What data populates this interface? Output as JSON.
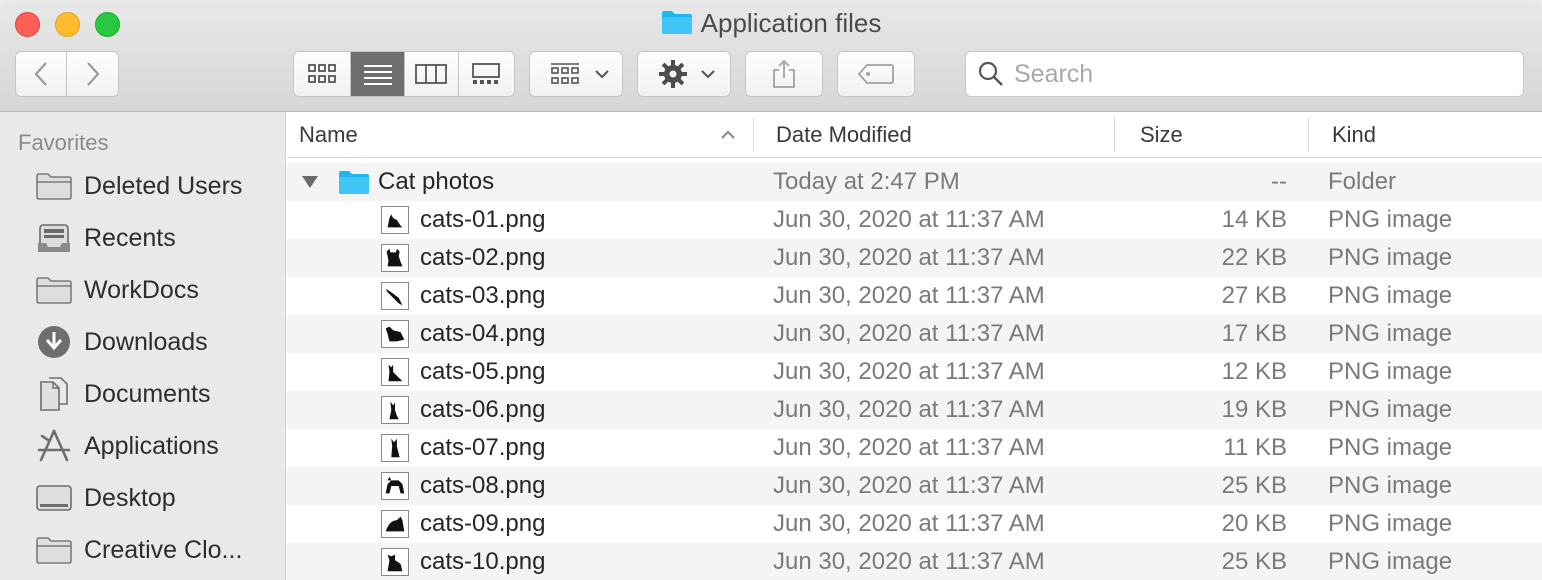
{
  "window": {
    "title": "Application files"
  },
  "toolbar": {
    "back_icon": "chevron-left-icon",
    "forward_icon": "chevron-right-icon",
    "view_modes": [
      "icon-view",
      "list-view",
      "column-view",
      "gallery-view"
    ],
    "active_view": "list-view",
    "group_icon": "group-grid-icon",
    "action_icon": "gear-icon",
    "share_icon": "share-icon",
    "tag_icon": "tag-icon"
  },
  "search": {
    "placeholder": "Search"
  },
  "sidebar": {
    "header": "Favorites",
    "items": [
      {
        "label": "Deleted Users",
        "icon": "folder-icon"
      },
      {
        "label": "Recents",
        "icon": "recents-icon"
      },
      {
        "label": "WorkDocs",
        "icon": "folder-icon"
      },
      {
        "label": "Downloads",
        "icon": "download-icon"
      },
      {
        "label": "Documents",
        "icon": "documents-icon"
      },
      {
        "label": "Applications",
        "icon": "applications-icon"
      },
      {
        "label": "Desktop",
        "icon": "desktop-icon"
      },
      {
        "label": "Creative Clo...",
        "icon": "folder-icon"
      }
    ]
  },
  "columns": {
    "name": "Name",
    "date": "Date Modified",
    "size": "Size",
    "kind": "Kind"
  },
  "folder": {
    "name": "Cat photos",
    "date": "Today at 2:47 PM",
    "size": "--",
    "kind": "Folder"
  },
  "files": [
    {
      "name": "cats-01.png",
      "date": "Jun 30, 2020 at 11:37 AM",
      "size": "14 KB",
      "kind": "PNG image"
    },
    {
      "name": "cats-02.png",
      "date": "Jun 30, 2020 at 11:37 AM",
      "size": "22 KB",
      "kind": "PNG image"
    },
    {
      "name": "cats-03.png",
      "date": "Jun 30, 2020 at 11:37 AM",
      "size": "27 KB",
      "kind": "PNG image"
    },
    {
      "name": "cats-04.png",
      "date": "Jun 30, 2020 at 11:37 AM",
      "size": "17 KB",
      "kind": "PNG image"
    },
    {
      "name": "cats-05.png",
      "date": "Jun 30, 2020 at 11:37 AM",
      "size": "12 KB",
      "kind": "PNG image"
    },
    {
      "name": "cats-06.png",
      "date": "Jun 30, 2020 at 11:37 AM",
      "size": "19 KB",
      "kind": "PNG image"
    },
    {
      "name": "cats-07.png",
      "date": "Jun 30, 2020 at 11:37 AM",
      "size": "11 KB",
      "kind": "PNG image"
    },
    {
      "name": "cats-08.png",
      "date": "Jun 30, 2020 at 11:37 AM",
      "size": "25 KB",
      "kind": "PNG image"
    },
    {
      "name": "cats-09.png",
      "date": "Jun 30, 2020 at 11:37 AM",
      "size": "20 KB",
      "kind": "PNG image"
    },
    {
      "name": "cats-10.png",
      "date": "Jun 30, 2020 at 11:37 AM",
      "size": "25 KB",
      "kind": "PNG image"
    }
  ],
  "colors": {
    "folder_blue": "#1eb8f0",
    "close": "#fe5f57",
    "minimize": "#febc2e",
    "maximize": "#28c840"
  }
}
